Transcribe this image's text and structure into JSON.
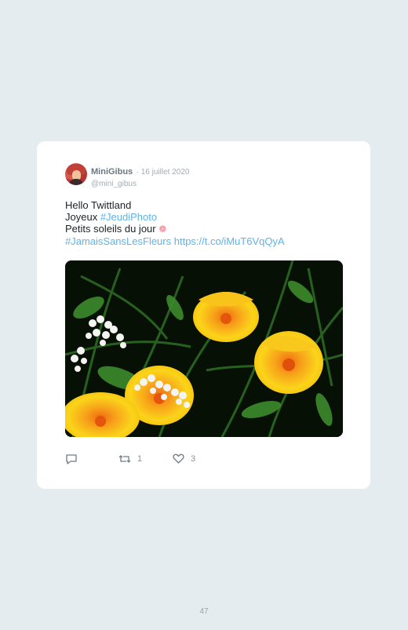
{
  "tweet": {
    "display_name": "MiniGibus",
    "date": "· 16 juillet 2020",
    "handle": "@mini_gibus",
    "lines": {
      "line1": "Hello Twittland",
      "line2_prefix": "Joyeux ",
      "line2_hashtag": "#JeudiPhoto",
      "line3": "Petits soleils du jour",
      "line4_hashtag": "#JamaisSansLesFleurs",
      "line4_url": "https://t.co/iMuT6VqQyA"
    },
    "link_color": "#5fb3e8",
    "media_icon": "flower-photo",
    "actions": {
      "reply_icon": "reply-icon",
      "retweet_icon": "retweet-icon",
      "retweet_count": "1",
      "like_icon": "heart-icon",
      "like_count": "3"
    }
  },
  "page_number": "47"
}
